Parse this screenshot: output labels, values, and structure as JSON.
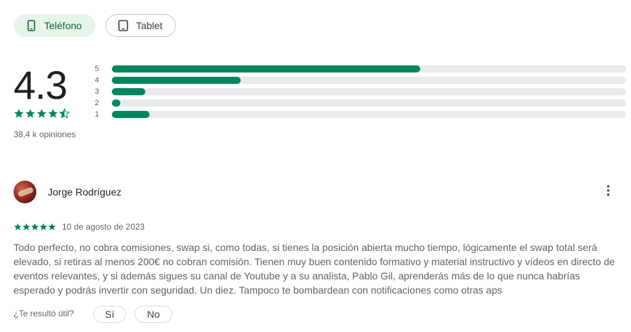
{
  "device_tabs": [
    {
      "label": "Teléfono",
      "icon": "phone-icon",
      "selected": true
    },
    {
      "label": "Tablet",
      "icon": "tablet-icon",
      "selected": false
    }
  ],
  "rating": {
    "score": "4.3",
    "stars": 4.5,
    "count_label": "38,4 k opiniones",
    "distribution": [
      {
        "label": "5",
        "fraction": 0.6
      },
      {
        "label": "4",
        "fraction": 0.25
      },
      {
        "label": "3",
        "fraction": 0.065
      },
      {
        "label": "2",
        "fraction": 0.017
      },
      {
        "label": "1",
        "fraction": 0.073
      }
    ]
  },
  "review": {
    "author": "Jorge Rodríguez",
    "stars": 5,
    "date": "10 de agosto de 2023",
    "text": "Todo perfecto, no cobra comisiones, swap si, como todas, si tienes la posición abierta mucho tiempo, lógicamente el swap total será elevado, si retiras al menos 200€ no cobran comisión. Tienen muy buen contenido formativo y material instructivo y vídeos en directo de eventos relevantes, y si además sigues su canal de Youtube y a su analista, Pablo Gil, aprenderás más de lo que nunca habrías esperado y podrás invertir con seguridad. Un diez. Tampoco te bombardean con notificaciones como otras aps",
    "helpful_question": "¿Te resultó útil?",
    "yes_label": "Sí",
    "no_label": "No"
  },
  "colors": {
    "accent": "#01875f",
    "track": "#e8eaed",
    "chip_selected_bg": "#e6f4ea"
  }
}
